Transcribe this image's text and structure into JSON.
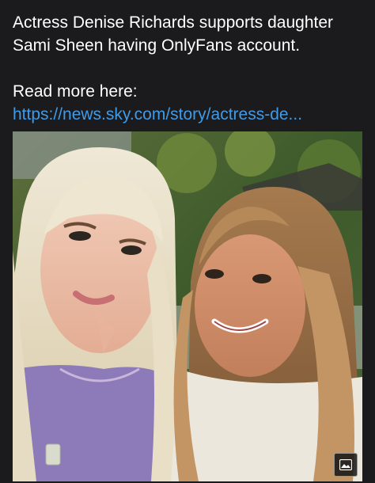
{
  "post": {
    "headline_line1": "Actress Denise Richards supports daughter",
    "headline_line2": "Sami Sheen having OnlyFans account.",
    "read_more_label": "Read more here:",
    "link_text": "https://news.sky.com/story/actress-de..."
  },
  "photo": {
    "image_icon": "image-icon"
  },
  "colors": {
    "background": "#1b1b1d",
    "text": "#ffffff",
    "link": "#3f9be8"
  }
}
